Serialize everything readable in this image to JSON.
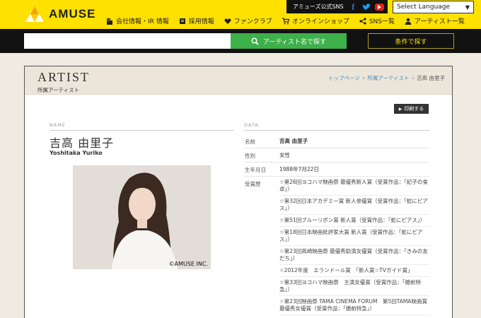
{
  "header": {
    "logo_text": "AMUSE",
    "sns_label": "アミューズ公式SNS",
    "language_select": "Select Language",
    "nav": [
      {
        "label": "会社情報・IR 情報",
        "icon": "building-icon"
      },
      {
        "label": "採用情報",
        "icon": "recruit-icon"
      },
      {
        "label": "ファンクラブ",
        "icon": "heart-icon"
      },
      {
        "label": "オンラインショップ",
        "icon": "cart-icon"
      },
      {
        "label": "SNS一覧",
        "icon": "share-icon"
      },
      {
        "label": "アーティスト一覧",
        "icon": "person-icon"
      }
    ]
  },
  "search": {
    "placeholder": "",
    "button_label": "アーティスト名で探す",
    "condition_label": "条件で探す"
  },
  "page": {
    "title": "ARTIST",
    "subtitle": "所属アーティスト",
    "breadcrumb": [
      "トップページ",
      "所属アーティスト",
      "吉高 由里子"
    ],
    "print_label": "印刷する"
  },
  "profile": {
    "name_section": "NAME",
    "name_jp": "吉高 由里子",
    "name_en": "Yoshitaka Yuriko",
    "photo_credit": "©AMUSE INC.",
    "data_section": "DATA",
    "rows": [
      {
        "key": "名前",
        "value": "吉高 由里子"
      },
      {
        "key": "性別",
        "value": "女性"
      },
      {
        "key": "生年月日",
        "value": "1988年7月22日"
      }
    ],
    "awards_key": "受賞歴",
    "awards": [
      "☆第26回ヨコハマ映画祭 最優秀新人賞（受賞作品：「紀子の食卓」）",
      "☆第32回日本アカデミー賞 新人俳優賞（受賞作品：「蛇にピアス」）",
      "☆第51回ブルーリボン賞 新人賞（受賞作品：「蛇にピアス」）",
      "☆第18回日本映画批評家大賞 新人賞（受賞作品：「蛇にピアス」）",
      "☆第23回高崎映画祭 最優秀助演女優賞（受賞作品：「きみの友だち」）",
      "☆2012年度　エランドール賞　「新人賞☆TVガイド賞」",
      "☆第33回ヨコハマ映画祭　主演女優賞（受賞作品：「婚前特急」）",
      "☆第23回映画祭 TAMA CINEMA FORUM　第5回TAMA映画賞 最優秀女優賞（受賞作品：「婚前特急」）"
    ]
  },
  "colors": {
    "brand": "#ffe100",
    "search_green": "#3db04a",
    "link": "#4a8bb8"
  }
}
